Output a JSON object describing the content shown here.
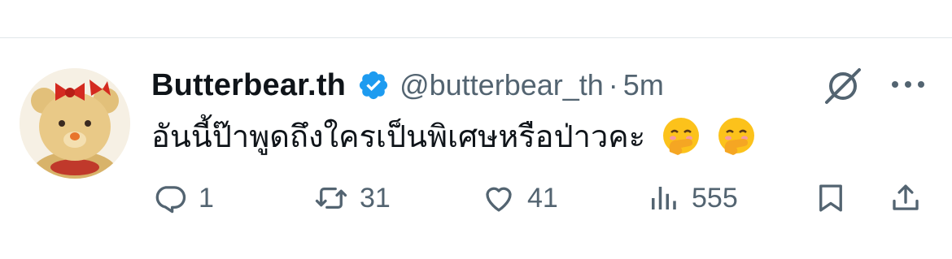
{
  "tweet": {
    "author_name": "Butterbear.th",
    "author_handle": "@butterbear_th",
    "separator": "·",
    "time": "5m",
    "text": "อันนี้ป๊าพูดถึงใครเป็นพิเศษหรือป่าวคะ",
    "emojis": [
      "hand-over-mouth-emoji",
      "hand-over-mouth-emoji"
    ],
    "verified": true
  },
  "actions": {
    "replies": "1",
    "retweets": "31",
    "likes": "41",
    "views": "555"
  },
  "colors": {
    "text": "#0f1419",
    "muted": "#536471",
    "verified_blue": "#1d9bf0",
    "divider": "#e1e6ea"
  }
}
